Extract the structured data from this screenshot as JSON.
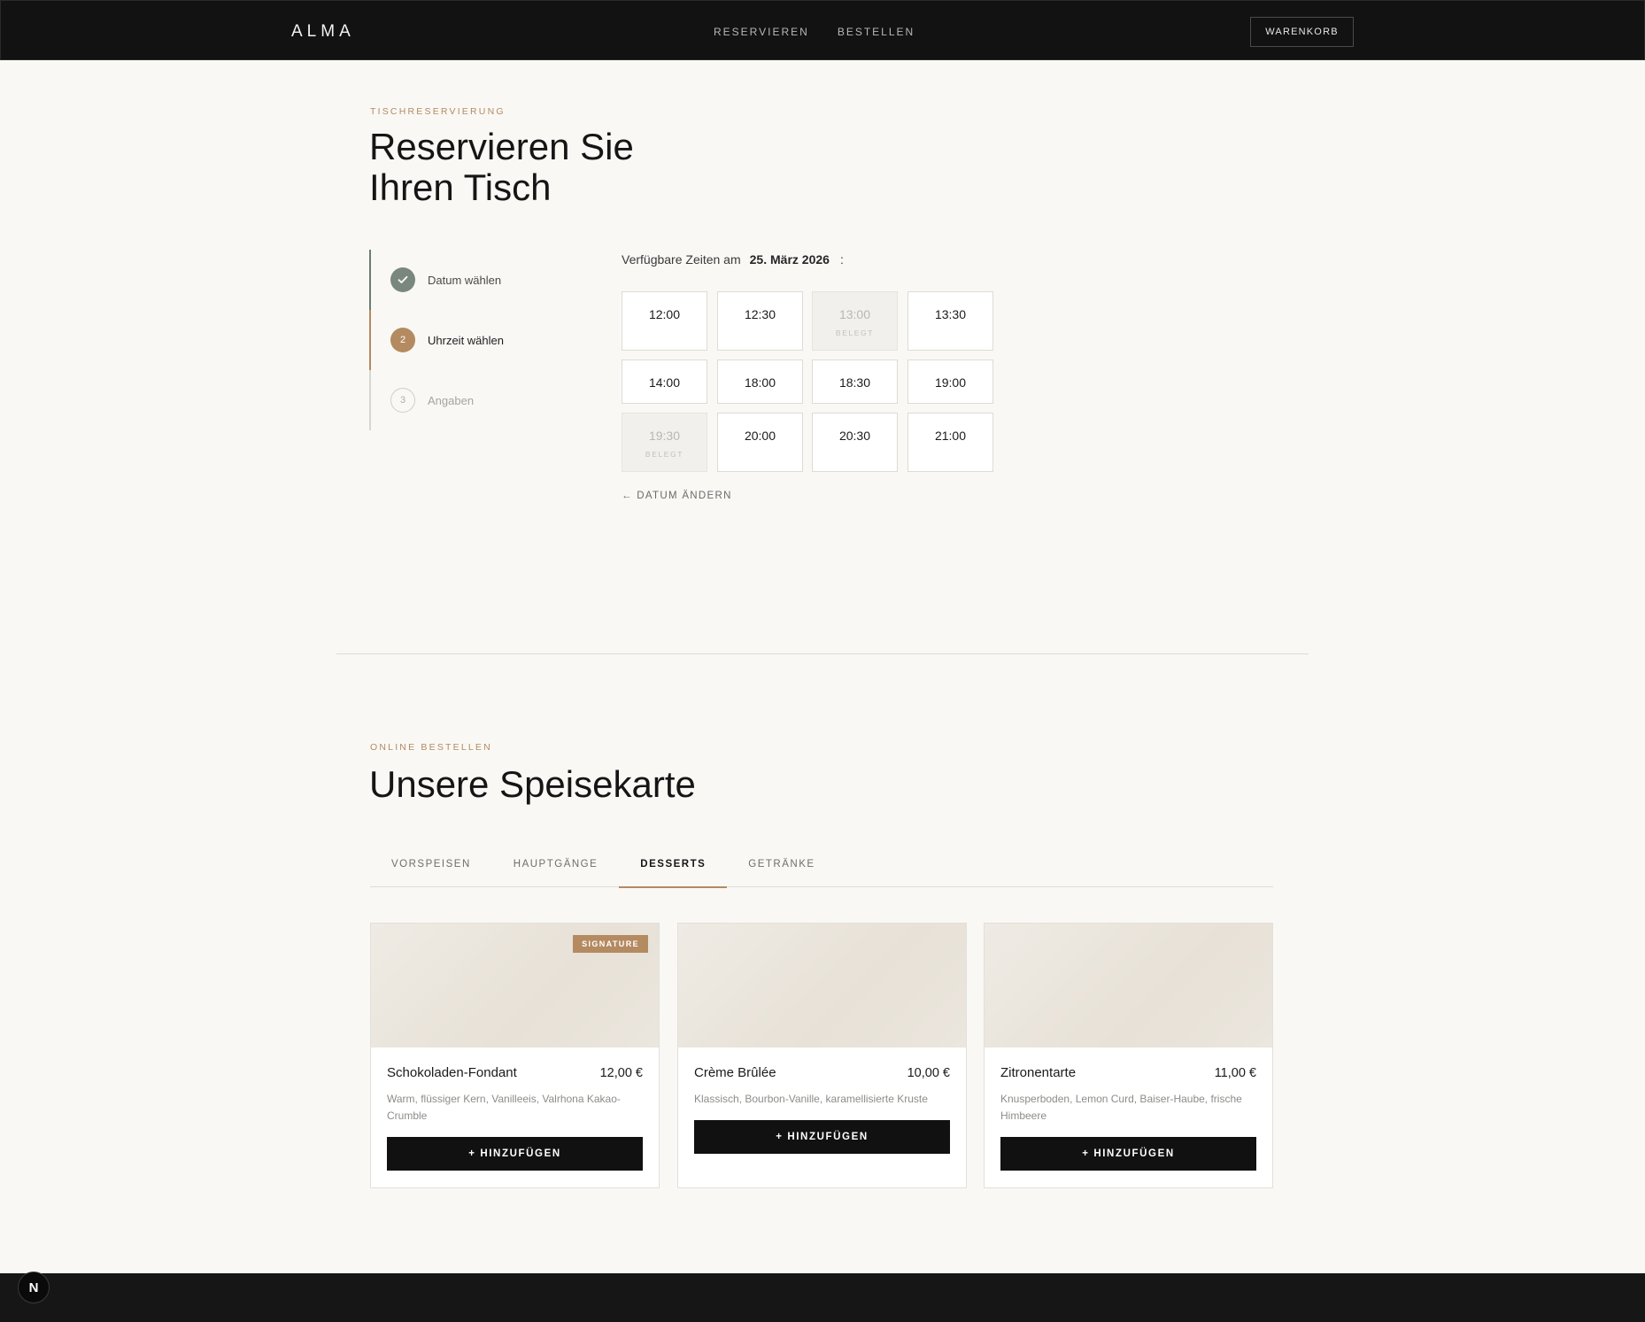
{
  "header": {
    "logo": "ALMA",
    "nav": [
      "RESERVIEREN",
      "BESTELLEN"
    ],
    "cart_label": "WARENKORB"
  },
  "reservation": {
    "eyebrow": "TISCHRESERVIERUNG",
    "title_line1": "Reservieren Sie",
    "title_line2": "Ihren Tisch",
    "steps": [
      {
        "number": "✓",
        "label": "Datum wählen",
        "state": "done"
      },
      {
        "number": "2",
        "label": "Uhrzeit wählen",
        "state": "active"
      },
      {
        "number": "3",
        "label": "Angaben",
        "state": "pending"
      }
    ],
    "available_prefix": "Verfügbare Zeiten am",
    "date": "25. März 2026",
    "colon": ":",
    "slots": [
      {
        "time": "12:00",
        "busy": false
      },
      {
        "time": "12:30",
        "busy": false
      },
      {
        "time": "13:00",
        "busy": true
      },
      {
        "time": "13:30",
        "busy": false
      },
      {
        "time": "14:00",
        "busy": false
      },
      {
        "time": "18:00",
        "busy": false
      },
      {
        "time": "18:30",
        "busy": false
      },
      {
        "time": "19:00",
        "busy": false
      },
      {
        "time": "19:30",
        "busy": true
      },
      {
        "time": "20:00",
        "busy": false
      },
      {
        "time": "20:30",
        "busy": false
      },
      {
        "time": "21:00",
        "busy": false
      }
    ],
    "busy_label": "BELEGT",
    "change_date": "← DATUM ÄNDERN"
  },
  "menu": {
    "eyebrow": "ONLINE BESTELLEN",
    "title": "Unsere Speisekarte",
    "tabs": [
      "VORSPEISEN",
      "HAUPTGÄNGE",
      "DESSERTS",
      "GETRÄNKE"
    ],
    "active_tab": "DESSERTS",
    "add_label": "+ HINZUFÜGEN",
    "items": [
      {
        "name": "Schokoladen-Fondant",
        "price": "12,00 €",
        "desc": "Warm, flüssiger Kern, Vanilleeis, Valrhona Kakao-Crumble",
        "badge": "SIGNATURE"
      },
      {
        "name": "Crème Brûlée",
        "price": "10,00 €",
        "desc": "Klassisch, Bourbon-Vanille, karamellisierte Kruste",
        "badge": ""
      },
      {
        "name": "Zitronentarte",
        "price": "11,00 €",
        "desc": "Knusperboden, Lemon Curd, Baiser-Haube, frische Himbeere",
        "badge": ""
      }
    ]
  },
  "dev_badge": "N",
  "colors": {
    "accent": "#b48a60",
    "dark": "#121212",
    "done": "#7a877f",
    "bg": "#f9f8f5"
  }
}
